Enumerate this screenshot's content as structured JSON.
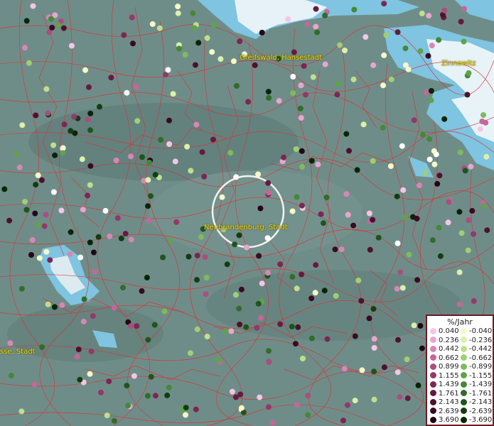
{
  "places": [
    {
      "id": "greifswald",
      "label": "Greifswald, Hansestadt"
    },
    {
      "id": "zinnowitz",
      "label": "Zinnowitz"
    },
    {
      "id": "neubrandenburg",
      "label": "Neubrandenburg, Stadt"
    },
    {
      "id": "west",
      "label": "sse, Stadt"
    }
  ],
  "legend": {
    "title": "%/Jahr",
    "positive": [
      {
        "label": "0.040",
        "color": "#f4c6e6"
      },
      {
        "label": "0.236",
        "color": "#e8a6cf"
      },
      {
        "label": "0.442",
        "color": "#d787b5"
      },
      {
        "label": "0.662",
        "color": "#c2689a"
      },
      {
        "label": "0.899",
        "color": "#ab4d80"
      },
      {
        "label": "1.155",
        "color": "#93386a"
      },
      {
        "label": "1.439",
        "color": "#7c2655"
      },
      {
        "label": "1.761",
        "color": "#661a41"
      },
      {
        "label": "2.143",
        "color": "#4f102f"
      },
      {
        "label": "2.639",
        "color": "#3a0a20"
      },
      {
        "label": "3.690",
        "color": "#250513"
      }
    ],
    "negative": [
      {
        "label": "-0.040",
        "color": "#f6f8c8"
      },
      {
        "label": "-0.236",
        "color": "#dcefab"
      },
      {
        "label": "-0.442",
        "color": "#bee08c"
      },
      {
        "label": "-0.662",
        "color": "#9fcf73"
      },
      {
        "label": "-0.899",
        "color": "#7fba5e"
      },
      {
        "label": "-1.155",
        "color": "#5fa34a"
      },
      {
        "label": "-1.439",
        "color": "#448838"
      },
      {
        "label": "-1.761",
        "color": "#2f6e29"
      },
      {
        "label": "-2.143",
        "color": "#1e551c"
      },
      {
        "label": "-2.639",
        "color": "#123d11"
      },
      {
        "label": "-3.690",
        "color": "#082607"
      }
    ]
  }
}
